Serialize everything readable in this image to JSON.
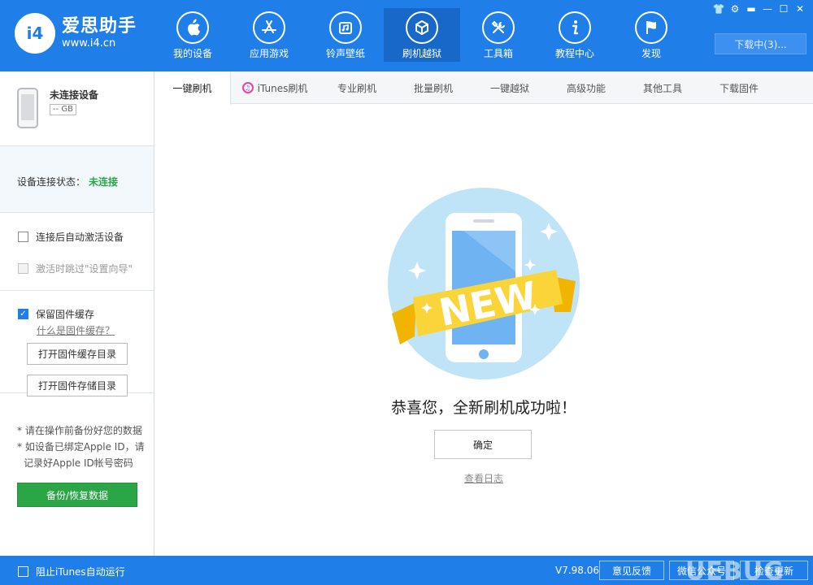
{
  "app": {
    "logo_badge": "i4",
    "title": "爱思助手",
    "url": "www.i4.cn",
    "colors": {
      "primary": "#1f7ee8",
      "active_nav": "#1868c9",
      "success": "#2aa646"
    }
  },
  "nav": {
    "items": [
      {
        "label": "我的设备",
        "icon": "apple-icon"
      },
      {
        "label": "应用游戏",
        "icon": "app-store-icon"
      },
      {
        "label": "铃声壁纸",
        "icon": "music-icon"
      },
      {
        "label": "刷机越狱",
        "icon": "box-icon",
        "active": true
      },
      {
        "label": "工具箱",
        "icon": "tools-icon"
      },
      {
        "label": "教程中心",
        "icon": "info-icon"
      },
      {
        "label": "发现",
        "icon": "flag-icon"
      }
    ],
    "download_label": "下载中(3)..."
  },
  "sidebar": {
    "device_name": "未连接设备",
    "device_size": "-- GB",
    "status_label": "设备连接状态：",
    "status_value": "未连接",
    "auto_activate": "连接后自动激活设备",
    "skip_wizard": "激活时跳过\"设置向导\"",
    "keep_cache": "保留固件缓存",
    "what_cache": "什么是固件缓存？",
    "open_cache_dir": "打开固件缓存目录",
    "open_store_dir": "打开固件存储目录",
    "note1": "* 请在操作前备份好您的数据",
    "note2": "* 如设备已绑定Apple ID，请",
    "note3": "记录好Apple ID帐号密码",
    "backup_button": "备份/恢复数据"
  },
  "tabs": [
    {
      "label": "一键刷机",
      "active": true
    },
    {
      "label": "iTunes刷机"
    },
    {
      "label": "专业刷机"
    },
    {
      "label": "批量刷机"
    },
    {
      "label": "一键越狱"
    },
    {
      "label": "高级功能"
    },
    {
      "label": "其他工具"
    },
    {
      "label": "下载固件"
    }
  ],
  "main": {
    "banner_text": "NEW",
    "message": "恭喜您，全新刷机成功啦！",
    "ok_button": "确定",
    "view_log": "查看日志"
  },
  "footer": {
    "block_itunes": "阻止iTunes自动运行",
    "version": "V7.98.06",
    "feedback": "意见反馈",
    "wechat": "微信公众号",
    "check_update": "检查更新",
    "watermark": "UEBUG"
  }
}
